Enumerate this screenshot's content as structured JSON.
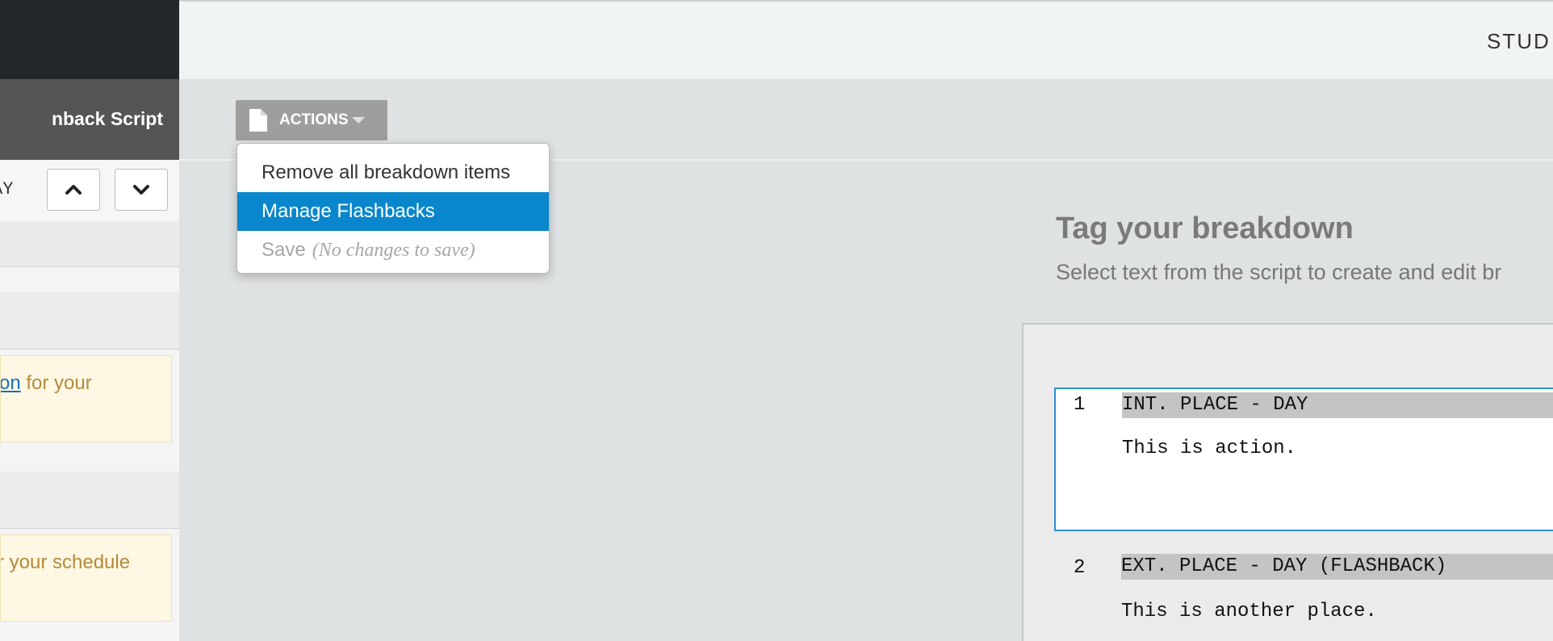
{
  "sidebar": {
    "title": "nback Script",
    "scene_label": "AY",
    "prev_button_icon": "chevron-up-icon",
    "next_button_icon": "chevron-down-icon",
    "notes": [
      {
        "link": "on",
        "text": " for your"
      },
      {
        "text": "r your schedule"
      }
    ]
  },
  "topbar": {
    "studio_label": "STUD"
  },
  "actions": {
    "label": "ACTIONS",
    "icon": "document-icon",
    "menu": [
      {
        "label": "Remove all breakdown items"
      },
      {
        "label": "Manage Flashbacks"
      },
      {
        "label": "Save",
        "hint": "(No changes to save)"
      }
    ]
  },
  "breakdown": {
    "title": "Tag your breakdown",
    "subtitle": "Select text from the script to create and edit br"
  },
  "script": {
    "scenes": [
      {
        "number": "1",
        "heading": "INT. PLACE - DAY",
        "action": "This is action."
      },
      {
        "number": "2",
        "heading": "EXT. PLACE - DAY (FLASHBACK)",
        "action": "This is another place."
      }
    ]
  },
  "colors": {
    "accent": "#0a87cc",
    "selection_border": "#2d8fd6",
    "note_text": "#b48a3c",
    "note_bg": "#fdf7e3"
  }
}
